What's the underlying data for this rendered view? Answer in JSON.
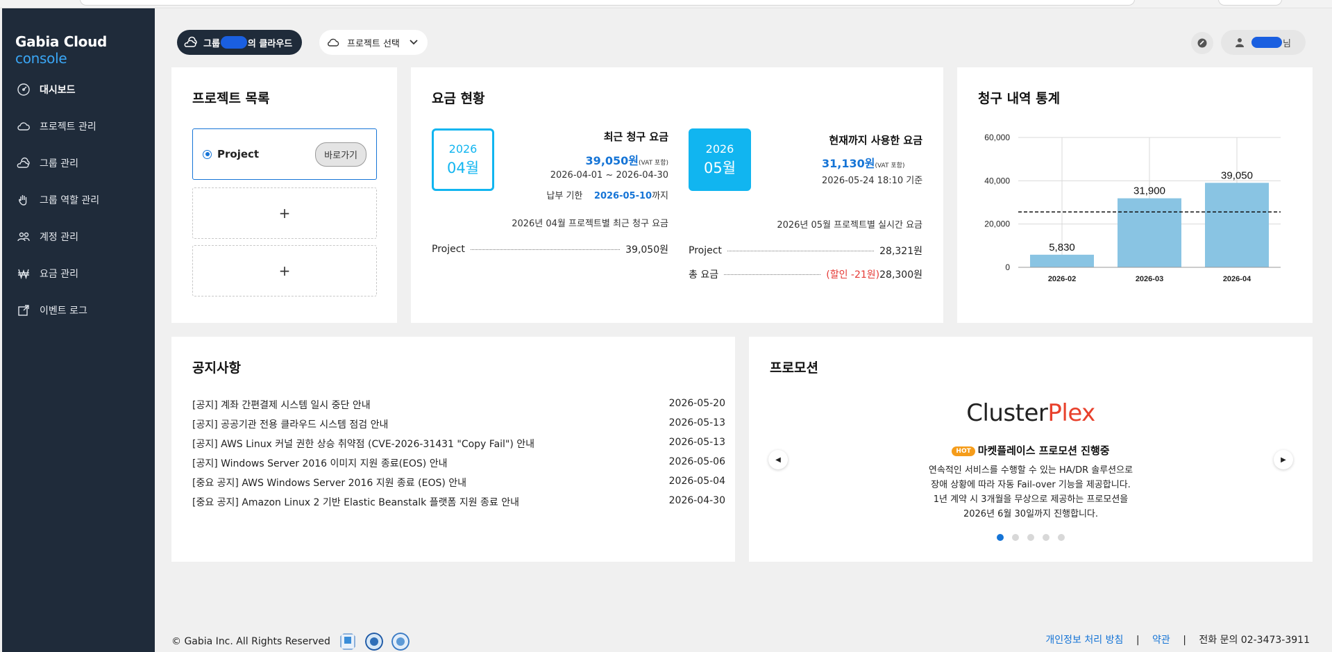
{
  "brand": {
    "name": "Gabia Cloud",
    "suffix": "console"
  },
  "sidebar": {
    "items": [
      {
        "label": "대시보드",
        "icon": "dashboard-icon",
        "active": true
      },
      {
        "label": "프로젝트 관리",
        "icon": "cloud-icon"
      },
      {
        "label": "그룹 관리",
        "icon": "group-cloud-icon"
      },
      {
        "label": "그룹 역할 관리",
        "icon": "hand-icon"
      },
      {
        "label": "계정 관리",
        "icon": "users-icon"
      },
      {
        "label": "요금 관리",
        "icon": "won-icon"
      },
      {
        "label": "이벤트 로그",
        "icon": "log-icon"
      }
    ]
  },
  "header": {
    "group_prefix": "그룹",
    "group_suffix": "의 클라우드",
    "project_select": "프로젝트 선택",
    "user_suffix": "님"
  },
  "projects": {
    "title": "프로젝트 목록",
    "item_name": "Project",
    "go_label": "바로가기",
    "add_label": "+"
  },
  "billing": {
    "title": "요금 현황",
    "recent": {
      "year": "2026",
      "month": "04월",
      "label": "최근 청구 요금",
      "amount": "39,050원",
      "vat": "(VAT 포함)",
      "period": "2026-04-01 ~ 2026-04-30",
      "due_prefix": "납부 기한",
      "due_date": "2026-05-10",
      "due_suffix": "까지",
      "caption": "2026년 04월 프로젝트별 최근 청구 요금",
      "rows": [
        {
          "name": "Project",
          "value": "39,050원"
        }
      ]
    },
    "current": {
      "year": "2026",
      "month": "05월",
      "label": "현재까지 사용한 요금",
      "amount": "31,130원",
      "vat": "(VAT 포함)",
      "asof": "2026-05-24 18:10 기준",
      "caption": "2026년 05월 프로젝트별 실시간 요금",
      "rows": [
        {
          "name": "Project",
          "value": "28,321원"
        }
      ],
      "total_label": "총 요금",
      "discount": "(할인 -21원)",
      "total": "28,300원"
    }
  },
  "stats": {
    "title": "청구 내역 통계"
  },
  "chart_data": {
    "type": "bar",
    "categories": [
      "2026-02",
      "2026-03",
      "2026-04"
    ],
    "values": [
      5830,
      31900,
      39050
    ],
    "value_labels": [
      "5,830",
      "31,900",
      "39,050"
    ],
    "yticks": [
      "0",
      "20,000",
      "40,000",
      "60,000"
    ],
    "ylim": [
      0,
      60000
    ],
    "average_line": 25593,
    "bar_color": "#89c4e3",
    "grid": true
  },
  "notices": {
    "title": "공지사항",
    "items": [
      {
        "text": "[공지] 계좌 간편결제 시스템 일시 중단 안내",
        "date": "2026-05-20"
      },
      {
        "text": "[공지] 공공기관 전용 클라우드 시스템 점검 안내",
        "date": "2026-05-13"
      },
      {
        "text": "[공지] AWS Linux 커널 권한 상승 취약점 (CVE-2026-31431 \"Copy Fail\") 안내",
        "date": "2026-05-13"
      },
      {
        "text": "[공지] Windows Server 2016 이미지 지원 종료(EOS) 안내",
        "date": "2026-05-06"
      },
      {
        "text": "[중요 공지] AWS Windows Server 2016 지원 종료 (EOS) 안내",
        "date": "2026-05-04"
      },
      {
        "text": "[중요 공지] Amazon Linux 2 기반 Elastic Beanstalk 플랫폼 지원 종료 안내",
        "date": "2026-04-30"
      }
    ]
  },
  "promotion": {
    "title": "프로모션",
    "logo_a": "Cluster",
    "logo_b": "Plex",
    "hot": "HOT",
    "subtitle": "마켓플레이스 프로모션 진행중",
    "lines": [
      "연속적인 서비스를 수행할 수 있는 HA/DR 솔루션으로",
      "장애 상황에 따라 자동 Fail-over 기능을 제공합니다.",
      "1년 계약 시 3개월을 무상으로 제공하는 프로모션을",
      "2026년 6월 30일까지 진행합니다."
    ],
    "slide_count": 5,
    "active_slide": 1
  },
  "footer": {
    "copyright": "© Gabia Inc. All Rights Reserved",
    "privacy": "개인정보 처리 방침",
    "terms": "약관",
    "sep": "|",
    "contact": "전화 문의 02-3473-3911"
  }
}
